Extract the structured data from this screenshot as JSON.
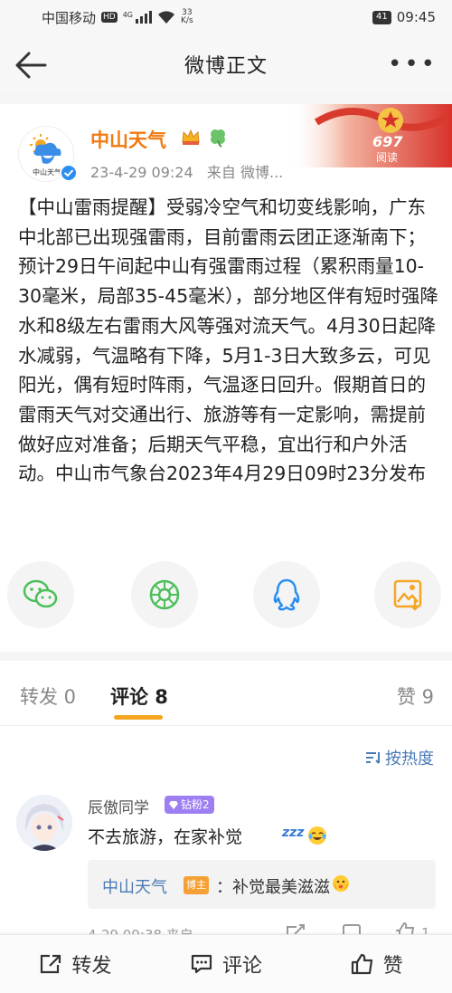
{
  "status_bar": {
    "carrier": "中国移动",
    "hd": "HD",
    "network": "4G",
    "speed": "33",
    "speed_unit": "K/s",
    "battery": "41",
    "time": "09:45"
  },
  "nav": {
    "title": "微博正文",
    "back_icon": "back-arrow-icon",
    "more_icon": "more-dots-icon"
  },
  "post": {
    "author": "中山天气",
    "avatar_label": "中山天气",
    "timestamp": "23-4-29 09:24",
    "source": "来自 微博...",
    "read_count": "697",
    "read_label": "阅读",
    "text": "【中山雷雨提醒】受弱冷空气和切变线影响，广东中北部已出现强雷雨，目前雷雨云团正逐渐南下；预计29日午间起中山有强雷雨过程（累积雨量10-30毫米，局部35-45毫米），部分地区伴有短时强降水和8级左右雷雨大风等强对流天气。4月30日起降水减弱，气温略有下降，5月1-3日大致多云，可见阳光，偶有短时阵雨，气温逐日回升。假期首日的雷雨天气对交通出行、旅游等有一定影响，需提前做好应对准备；后期天气平稳，宜出行和户外活动。中山市气象台2023年4月29日09时23分发布"
  },
  "share_buttons": [
    {
      "name": "wechat-icon",
      "color": "#4cbf5a"
    },
    {
      "name": "moments-icon",
      "color": "#4cbf5a"
    },
    {
      "name": "qq-icon",
      "color": "#2b8ef0"
    },
    {
      "name": "save-image-icon",
      "color": "#f5a623"
    }
  ],
  "tabs": {
    "repost": "转发 0",
    "comments": "评论 8",
    "likes": "赞 9"
  },
  "sort": {
    "label": "按热度"
  },
  "comment": {
    "user": "辰傲同学",
    "fan_badge": "钻粉2",
    "text": "不去旅游，在家补觉",
    "zzz": "zzz",
    "reply": {
      "author": "中山天气",
      "badge": "博主",
      "text": "：补觉最美滋滋"
    },
    "meta": "4-29 09:38 来自",
    "like_count": "1"
  },
  "bottom_bar": {
    "repost": "转发",
    "comment": "评论",
    "like": "赞"
  },
  "colors": {
    "accent_orange": "#f07a10",
    "link_blue": "#4a7bb5",
    "tab_underline": "#f5a623"
  }
}
